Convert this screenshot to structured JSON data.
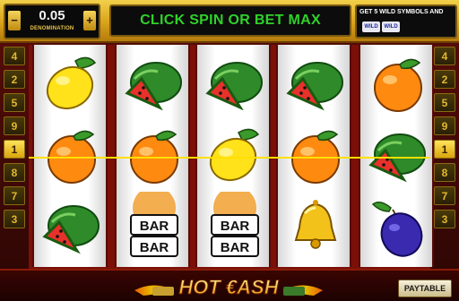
{
  "denomination": {
    "value": "0.05",
    "label": "DENOMINATION",
    "minus": "−",
    "plus": "+"
  },
  "message": "CLICK SPIN OR BET MAX",
  "promo": {
    "text": "GET 5 WILD SYMBOLS AND",
    "badge1": "WILD",
    "badge2": "WILD"
  },
  "paylines_left": [
    "4",
    "2",
    "5",
    "9",
    "1",
    "8",
    "7",
    "3"
  ],
  "paylines_right": [
    "4",
    "2",
    "5",
    "9",
    "1",
    "8",
    "7",
    "3"
  ],
  "active_payline": "1",
  "reels": [
    [
      "lemon",
      "orange",
      "watermelon"
    ],
    [
      "watermelon",
      "orange",
      "bar"
    ],
    [
      "watermelon",
      "lemon",
      "bar"
    ],
    [
      "watermelon",
      "orange",
      "bell"
    ],
    [
      "orange",
      "watermelon",
      "plum"
    ]
  ],
  "symbol_labels": {
    "bar_top": "BAR",
    "bar_bottom": "BAR"
  },
  "logo": "HOT €ASH",
  "paytable_label": "PAYTABLE"
}
